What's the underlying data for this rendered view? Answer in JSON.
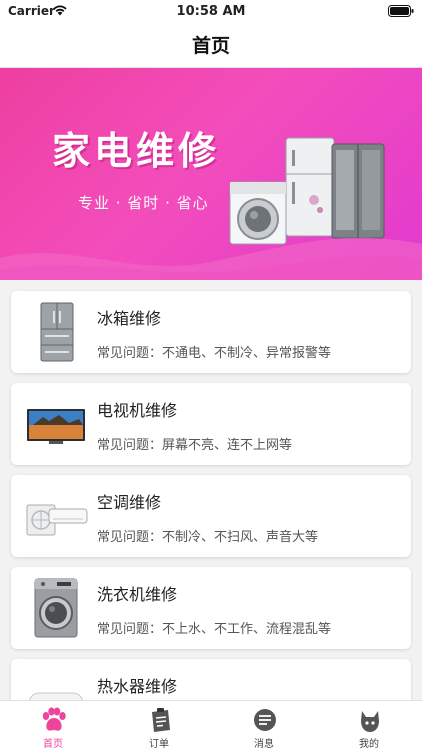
{
  "status_bar": {
    "carrier": "Carrier",
    "time": "10:58 AM"
  },
  "nav": {
    "title": "首页"
  },
  "banner": {
    "title": "家电维修",
    "subtitle": "专业 · 省时 · 省心"
  },
  "services": [
    {
      "title": "冰箱维修",
      "desc": "常见问题：不通电、不制冷、异常报警等",
      "icon": "fridge-icon"
    },
    {
      "title": "电视机维修",
      "desc": "常见问题：屏幕不亮、连不上网等",
      "icon": "tv-icon"
    },
    {
      "title": "空调维修",
      "desc": "常见问题：不制冷、不扫风、声音大等",
      "icon": "air-conditioner-icon"
    },
    {
      "title": "洗衣机维修",
      "desc": "常见问题：不上水、不工作、流程混乱等",
      "icon": "washing-machine-icon"
    },
    {
      "title": "热水器维修",
      "desc": "",
      "icon": "water-heater-icon"
    }
  ],
  "tabs": [
    {
      "label": "首页",
      "icon": "paw-icon",
      "active": true
    },
    {
      "label": "订单",
      "icon": "clipboard-icon",
      "active": false
    },
    {
      "label": "消息",
      "icon": "message-icon",
      "active": false
    },
    {
      "label": "我的",
      "icon": "cat-icon",
      "active": false
    }
  ],
  "colors": {
    "accent": "#f0449c",
    "banner_pink": "#ee3fa0",
    "banner_magenta": "#e23ad0"
  }
}
